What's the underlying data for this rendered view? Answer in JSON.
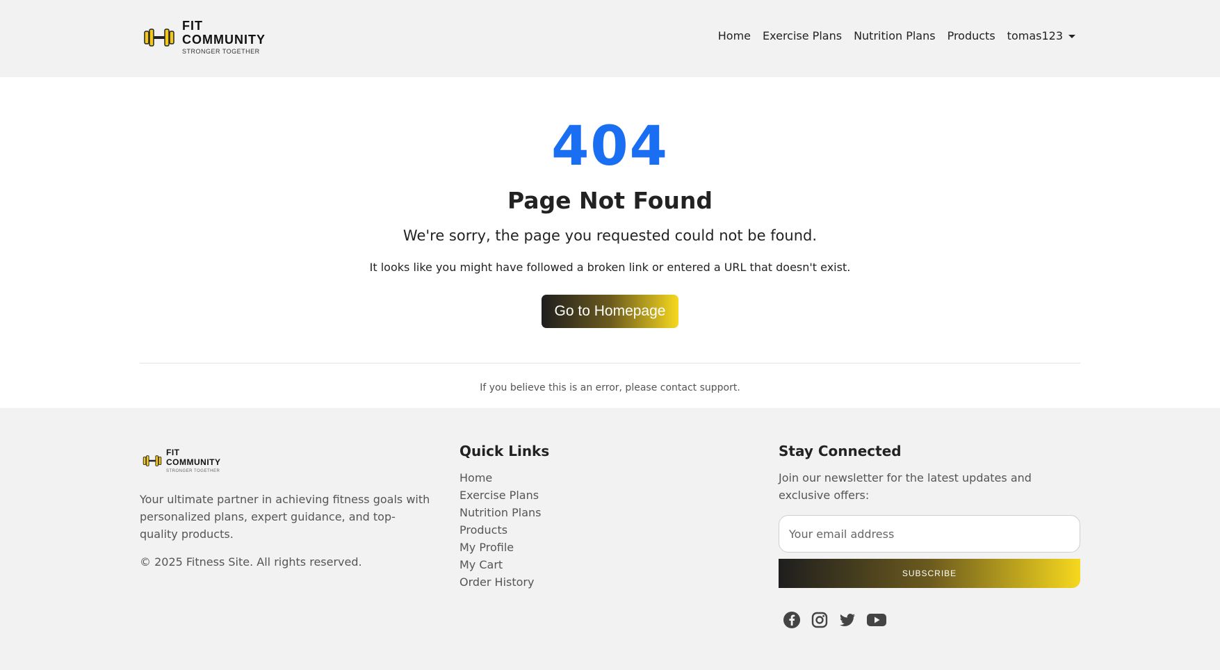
{
  "brand": {
    "line1": "FIT",
    "line2": "COMMUNITY",
    "tagline": "STRONGER TOGETHER"
  },
  "nav": {
    "items": [
      "Home",
      "Exercise Plans",
      "Nutrition Plans",
      "Products"
    ],
    "user": "tomas123"
  },
  "error": {
    "code": "404",
    "title": "Page Not Found",
    "message": "We're sorry, the page you requested could not be found.",
    "hint": "It looks like you might have followed a broken link or entered a URL that doesn't exist.",
    "button": "Go to Homepage",
    "support": "If you believe this is an error, please contact support."
  },
  "footer": {
    "about": "Your ultimate partner in achieving fitness goals with personalized plans, expert guidance, and top-quality products.",
    "copyright": "© 2025 Fitness Site. All rights reserved.",
    "quick_links_title": "Quick Links",
    "quick_links": [
      "Home",
      "Exercise Plans",
      "Nutrition Plans",
      "Products",
      "My Profile",
      "My Cart",
      "Order History"
    ],
    "connected_title": "Stay Connected",
    "newsletter_text": "Join our newsletter for the latest updates and exclusive offers:",
    "email_placeholder": "Your email address",
    "subscribe": "SUBSCRIBE",
    "social": [
      "facebook-icon",
      "instagram-icon",
      "twitter-icon",
      "youtube-icon"
    ]
  },
  "colors": {
    "accent_blue": "#1a6ef2",
    "gradient_start": "#1e1e1e",
    "gradient_end": "#f6d81e"
  }
}
